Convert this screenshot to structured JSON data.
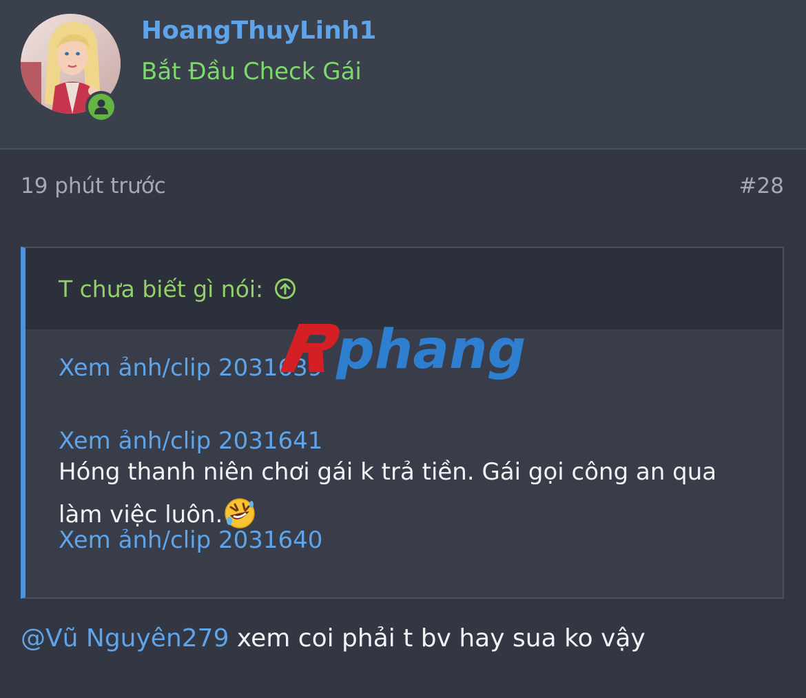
{
  "user": {
    "name": "HoangThuyLinh1",
    "title": "Bắt Đầu Check Gái",
    "avatar_icon": "avatar-image",
    "online_icon": "online-person-icon"
  },
  "post": {
    "time": "19 phút trước",
    "number": "#28"
  },
  "quote": {
    "author": "T chưa biết gì nói:",
    "jump_icon": "arrow-up-circle-icon",
    "links": [
      "Xem ảnh/clip 2031639",
      "Xem ảnh/clip 2031641",
      "Xem ảnh/clip 2031640"
    ],
    "text_line1": "Hóng thanh niên chơi gái k trả tiền. Gái gọi công an qua",
    "text_line2": "làm việc luôn.",
    "emoji": "rolling-on-floor-laughing-emoji"
  },
  "reply": {
    "mention": "@Vũ Nguyên279",
    "text": " xem coi phải t bv hay sua ko vậy"
  },
  "watermark": {
    "text": "phang",
    "colors": {
      "mark": "#d41f24",
      "text": "#2f7fd0"
    }
  },
  "colors": {
    "link": "#5fa3e8",
    "title_green": "#7cd96b",
    "quote_border": "#4f93dd",
    "online": "#63b443"
  }
}
